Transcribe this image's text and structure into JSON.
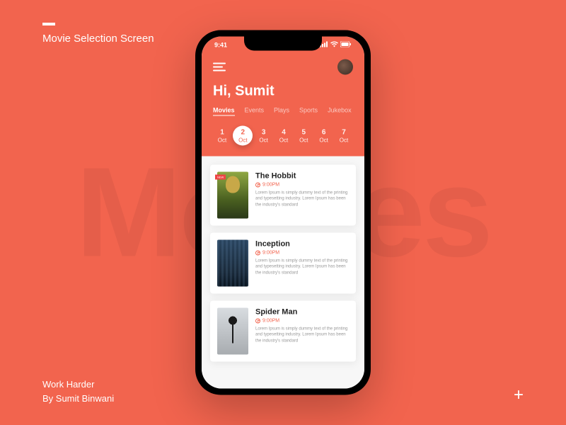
{
  "page": {
    "title": "Movie Selection Screen",
    "footer_line1": "Work Harder",
    "footer_line2": "By Sumit Binwani",
    "bg_word": "Movies"
  },
  "status": {
    "time": "9:41"
  },
  "header": {
    "greeting": "Hi, Sumit",
    "tabs": [
      "Movies",
      "Events",
      "Plays",
      "Sports",
      "Jukebox"
    ],
    "active_tab": 0,
    "dates": [
      {
        "num": "1",
        "mon": "Oct"
      },
      {
        "num": "2",
        "mon": "Oct"
      },
      {
        "num": "3",
        "mon": "Oct"
      },
      {
        "num": "4",
        "mon": "Oct"
      },
      {
        "num": "5",
        "mon": "Oct"
      },
      {
        "num": "6",
        "mon": "Oct"
      },
      {
        "num": "7",
        "mon": "Oct"
      }
    ],
    "active_date": 1
  },
  "movies": [
    {
      "title": "The Hobbit",
      "time": "9:00PM",
      "desc": "Lorem Ipsum is simply dummy text of the printing and typesetting industry. Lorem Ipsum has been the industry's standard"
    },
    {
      "title": "Inception",
      "time": "9:00PM",
      "desc": "Lorem Ipsum is simply dummy text of the printing and typesetting industry. Lorem Ipsum has been the industry's standard"
    },
    {
      "title": "Spider Man",
      "time": "9:00PM",
      "desc": "Lorem Ipsum is simply dummy text of the printing and typesetting industry. Lorem Ipsum has been the industry's standard"
    }
  ]
}
